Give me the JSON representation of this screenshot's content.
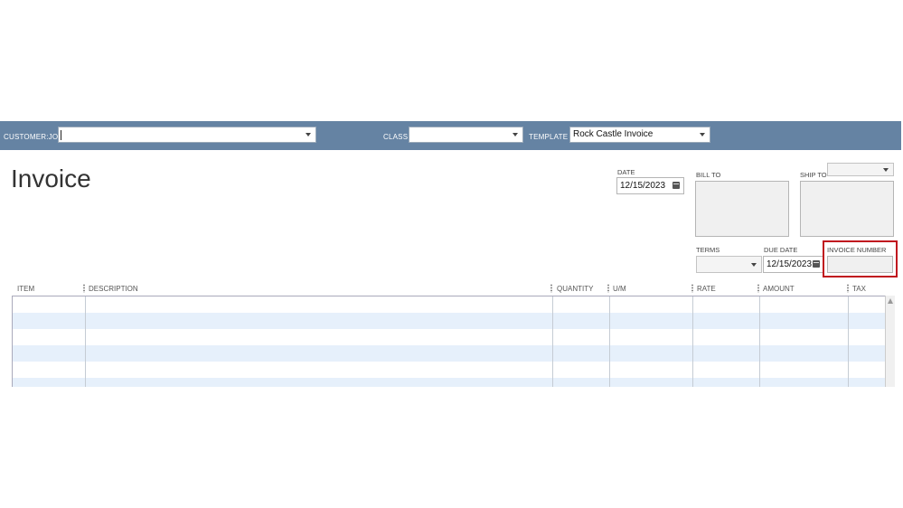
{
  "toolbar": {
    "customer_job_label": "CUSTOMER:JOB",
    "customer_job_value": "",
    "class_label": "CLASS",
    "class_value": "",
    "template_label": "TEMPLATE",
    "template_value": "Rock Castle Invoice"
  },
  "form": {
    "title": "Invoice",
    "date_label": "DATE",
    "date_value": "12/15/2023",
    "bill_to_label": "BILL TO",
    "ship_to_label": "SHIP TO",
    "terms_label": "TERMS",
    "terms_value": "",
    "due_date_label": "DUE DATE",
    "due_date_value": "12/15/2023",
    "invoice_number_label": "INVOICE NUMBER",
    "invoice_number_value": ""
  },
  "table": {
    "columns": [
      "ITEM",
      "DESCRIPTION",
      "QUANTITY",
      "U/M",
      "RATE",
      "AMOUNT",
      "TAX"
    ]
  },
  "colors": {
    "toolbar": "#6583a3",
    "row_alt": "#e6f0fb",
    "highlight": "#c0141e"
  },
  "icons": [
    "calendar-icon",
    "dropdown-arrow-icon",
    "scroll-up-icon"
  ]
}
